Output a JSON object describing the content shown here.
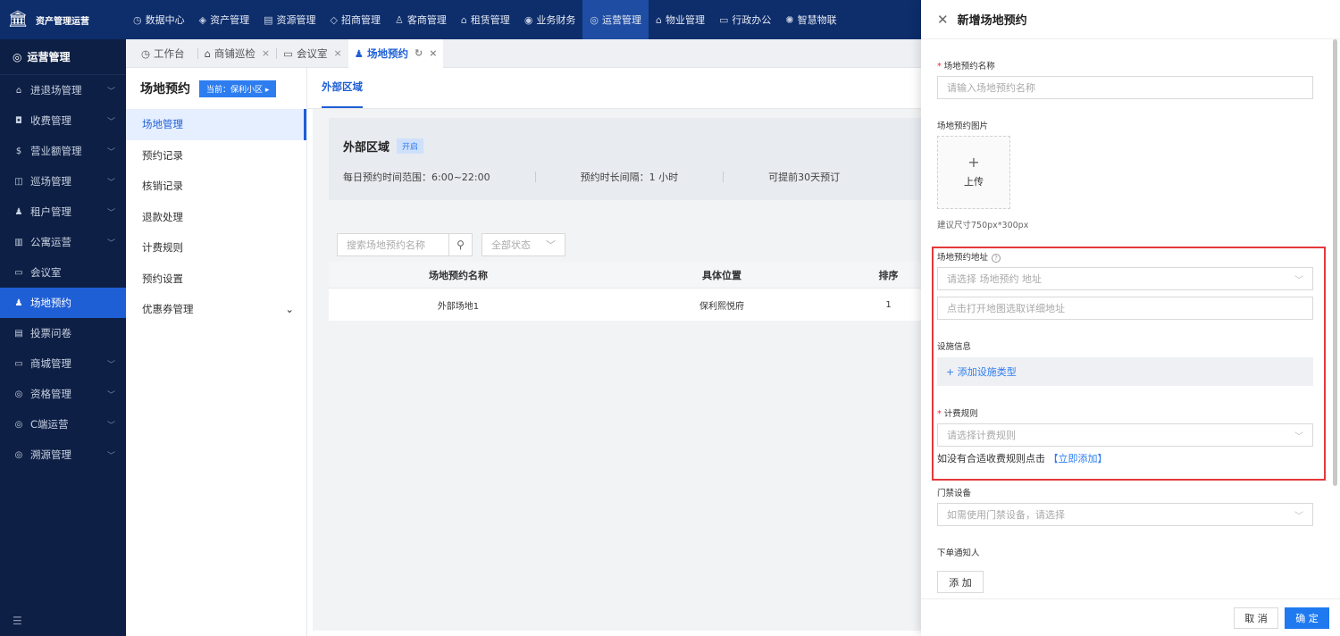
{
  "app": {
    "title": "资产管理运营"
  },
  "topnav": [
    {
      "icon": "◷",
      "label": "数据中心"
    },
    {
      "icon": "◈",
      "label": "资产管理"
    },
    {
      "icon": "▤",
      "label": "资源管理"
    },
    {
      "icon": "◇",
      "label": "招商管理"
    },
    {
      "icon": "♙",
      "label": "客商管理"
    },
    {
      "icon": "⌂",
      "label": "租赁管理"
    },
    {
      "icon": "◉",
      "label": "业务财务"
    },
    {
      "icon": "◎",
      "label": "运营管理"
    },
    {
      "icon": "⌂",
      "label": "物业管理"
    },
    {
      "icon": "▭",
      "label": "行政办公"
    },
    {
      "icon": "✺",
      "label": "智慧物联"
    }
  ],
  "sidebar": {
    "header": "运营管理",
    "items": [
      {
        "icon": "⌂",
        "label": "进退场管理",
        "chevron": "﹀"
      },
      {
        "icon": "◘",
        "label": "收费管理",
        "chevron": "﹀"
      },
      {
        "icon": "$",
        "label": "营业额管理",
        "chevron": "﹀"
      },
      {
        "icon": "◫",
        "label": "巡场管理",
        "chevron": "﹀"
      },
      {
        "icon": "♟",
        "label": "租户管理",
        "chevron": "﹀"
      },
      {
        "icon": "▥",
        "label": "公寓运营",
        "chevron": "﹀"
      },
      {
        "icon": "▭",
        "label": "会议室",
        "chevron": ""
      },
      {
        "icon": "♟",
        "label": "场地预约",
        "chevron": ""
      },
      {
        "icon": "▤",
        "label": "投票问卷",
        "chevron": ""
      },
      {
        "icon": "▭",
        "label": "商城管理",
        "chevron": "﹀"
      },
      {
        "icon": "◎",
        "label": "资格管理",
        "chevron": "﹀"
      },
      {
        "icon": "◎",
        "label": "C端运营",
        "chevron": "﹀"
      },
      {
        "icon": "◎",
        "label": "溯源管理",
        "chevron": "﹀"
      }
    ],
    "footer_icon": "☰"
  },
  "tabs": [
    {
      "icon": "◷",
      "label": "工作台",
      "close": ""
    },
    {
      "icon": "⌂",
      "label": "商铺巡检",
      "close": "×"
    },
    {
      "icon": "▭",
      "label": "会议室",
      "close": "×"
    },
    {
      "icon": "♟",
      "label": "场地预约",
      "refresh": "↻",
      "close": "×"
    }
  ],
  "subside": {
    "title": "场地预约",
    "current": "当前：保利小区 ▸",
    "items": [
      {
        "label": "场地管理",
        "chevron": ""
      },
      {
        "label": "预约记录",
        "chevron": ""
      },
      {
        "label": "核销记录",
        "chevron": ""
      },
      {
        "label": "退款处理",
        "chevron": ""
      },
      {
        "label": "计费规则",
        "chevron": ""
      },
      {
        "label": "预约设置",
        "chevron": ""
      },
      {
        "label": "优惠券管理",
        "chevron": "⌄"
      }
    ]
  },
  "main": {
    "tab": "外部区域",
    "area": {
      "title": "外部区域",
      "status": "开启",
      "info": [
        "每日预约时间范围：6:00~22:00",
        "预约时长间隔：1 小时",
        "可提前30天预订"
      ]
    },
    "search_placeholder": "搜索场地预约名称",
    "status_filter": "全部状态",
    "table": {
      "headers": [
        "场地预约名称",
        "具体位置",
        "排序"
      ],
      "rows": [
        [
          "外部场地1",
          "保利熙悦府",
          "1"
        ]
      ]
    }
  },
  "drawer": {
    "title": "新增场地预约",
    "name_label": "场地预约名称",
    "name_placeholder": "请输入场地预约名称",
    "image_label": "场地预约图片",
    "upload_plus": "+",
    "upload_label": "上传",
    "size_hint": "建议尺寸750px*300px",
    "address_label": "场地预约地址",
    "address_placeholder": "请选择 场地预约 地址",
    "map_placeholder": "点击打开地图选取详细地址",
    "facility_label": "设施信息",
    "facility_add": "+ 添加设施类型",
    "rule_label": "计费规则",
    "rule_placeholder": "请选择计费规则",
    "rule_hint": "如没有合适收费规则点击",
    "rule_link": "【立即添加】",
    "access_label": "门禁设备",
    "access_placeholder": "如需使用门禁设备，请选择",
    "notify_label": "下单通知人",
    "add_button": "添 加",
    "cancel": "取 消",
    "ok": "确 定"
  }
}
